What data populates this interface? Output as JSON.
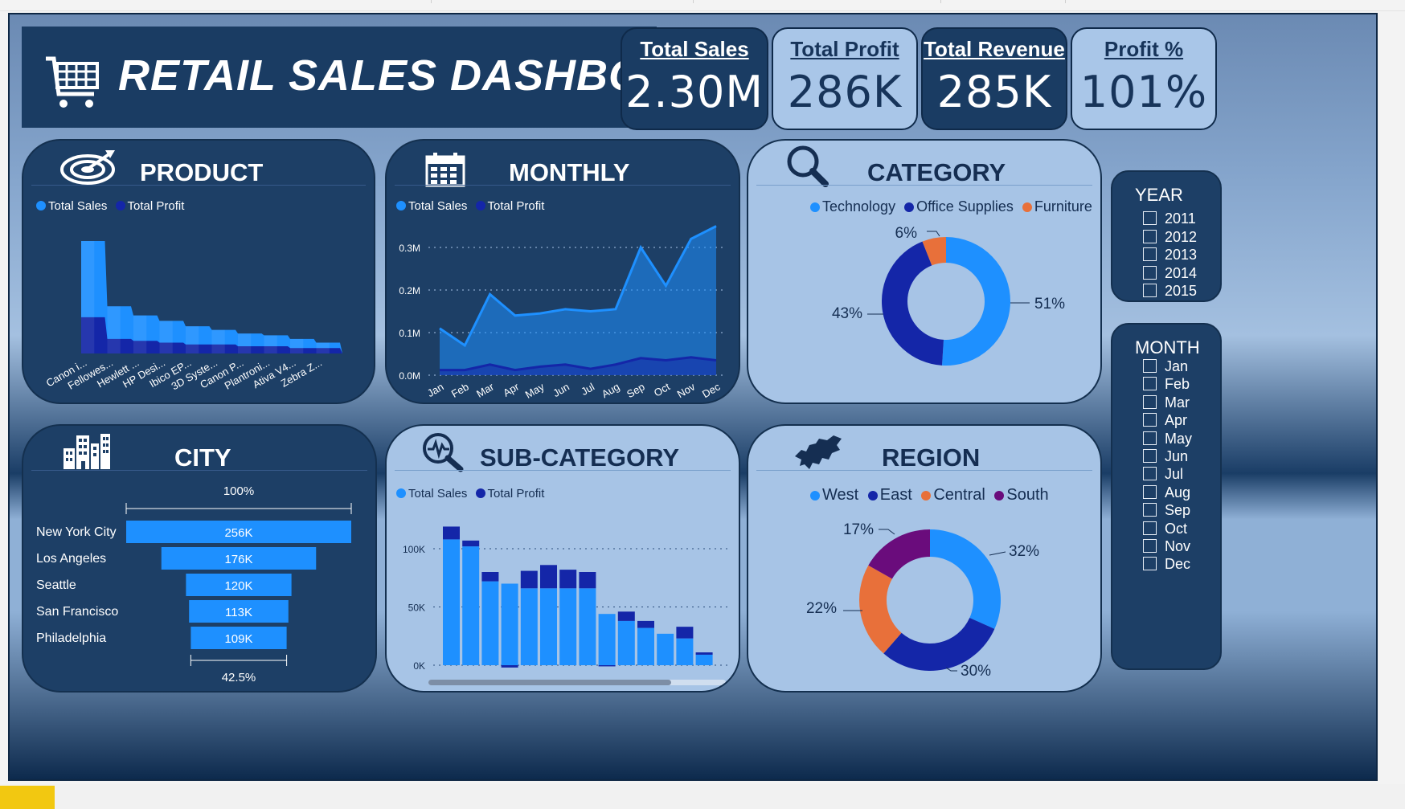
{
  "title": "RETAIL SALES DASHBOARD",
  "kpis": [
    {
      "label": "Total Sales",
      "value": "2.30M"
    },
    {
      "label": "Total Profit",
      "value": "286K"
    },
    {
      "label": "Total Revenue",
      "value": "285K"
    },
    {
      "label": "Profit %",
      "value": "101%"
    }
  ],
  "colors": {
    "sales": "#1e90ff",
    "profit": "#1426a8",
    "furniture": "#e8703a",
    "south": "#6a0c7c",
    "navy": "#1d3f66",
    "light": "#a7c4e6"
  },
  "panels": {
    "product": {
      "title": "PRODUCT",
      "icon": "target-icon"
    },
    "monthly": {
      "title": "MONTHLY",
      "icon": "calendar-icon"
    },
    "category": {
      "title": "CATEGORY",
      "icon": "magnifier-icon"
    },
    "city": {
      "title": "CITY",
      "icon": "buildings-icon"
    },
    "subcategory": {
      "title": "SUB-CATEGORY",
      "icon": "analytics-search-icon"
    },
    "region": {
      "title": "REGION",
      "icon": "world-map-icon"
    }
  },
  "legend_sales_profit": [
    "Total Sales",
    "Total Profit"
  ],
  "slicers": {
    "year": {
      "title": "YEAR",
      "options": [
        "2011",
        "2012",
        "2013",
        "2014",
        "2015"
      ]
    },
    "month": {
      "title": "MONTH",
      "options": [
        "Jan",
        "Feb",
        "Mar",
        "Apr",
        "May",
        "Jun",
        "Jul",
        "Aug",
        "Sep",
        "Oct",
        "Nov",
        "Dec"
      ]
    }
  },
  "chart_data": [
    {
      "id": "product",
      "type": "area",
      "categories": [
        "Canon i...",
        "Fellowes...",
        "Hewlett ...",
        "HP Desi...",
        "Ibico EP...",
        "3D Syste...",
        "Canon P...",
        "Plantroni...",
        "Ativa V4...",
        "Zebra Z..."
      ],
      "series": [
        {
          "name": "Total Sales",
          "values": [
            62,
            26,
            21,
            18,
            15,
            13,
            11,
            10,
            8,
            6
          ]
        },
        {
          "name": "Total Profit",
          "values": [
            20,
            8,
            7,
            6,
            5,
            5,
            4,
            4,
            3,
            3
          ]
        }
      ]
    },
    {
      "id": "monthly",
      "type": "area",
      "categories": [
        "Jan",
        "Feb",
        "Mar",
        "Apr",
        "May",
        "Jun",
        "Jul",
        "Aug",
        "Sep",
        "Oct",
        "Nov",
        "Dec"
      ],
      "yticks": [
        "0.0M",
        "0.1M",
        "0.2M",
        "0.3M"
      ],
      "ylim": [
        0,
        0.3
      ],
      "series": [
        {
          "name": "Total Sales",
          "values": [
            0.11,
            0.07,
            0.19,
            0.14,
            0.145,
            0.155,
            0.15,
            0.155,
            0.3,
            0.21,
            0.32,
            0.35
          ]
        },
        {
          "name": "Total Profit",
          "values": [
            0.012,
            0.012,
            0.025,
            0.012,
            0.02,
            0.025,
            0.015,
            0.025,
            0.04,
            0.035,
            0.042,
            0.035
          ]
        }
      ]
    },
    {
      "id": "category",
      "type": "pie",
      "labels": [
        "Technology",
        "Office Supplies",
        "Furniture"
      ],
      "values": [
        51,
        43,
        6
      ],
      "value_labels": [
        "51%",
        "43%",
        "6%"
      ],
      "colors": [
        "#1e90ff",
        "#1426a8",
        "#e8703a"
      ]
    },
    {
      "id": "city",
      "type": "bar",
      "categories": [
        "New York City",
        "Los Angeles",
        "Seattle",
        "San Francisco",
        "Philadelphia"
      ],
      "values": [
        256,
        176,
        120,
        113,
        109
      ],
      "value_labels": [
        "256K",
        "176K",
        "120K",
        "113K",
        "109K"
      ],
      "top_label": "100%",
      "bottom_label": "42.5%"
    },
    {
      "id": "subcategory",
      "type": "bar",
      "yticks": [
        "0K",
        "50K",
        "100K"
      ],
      "ylim": [
        0,
        100
      ],
      "series": [
        {
          "name": "Total Sales",
          "values": [
            108,
            102,
            72,
            70,
            66,
            66,
            66,
            66,
            44,
            38,
            32,
            27,
            23,
            9
          ]
        },
        {
          "name": "Total Profit",
          "values": [
            11,
            5,
            8,
            -2,
            15,
            20,
            16,
            14,
            -1,
            8,
            6,
            0,
            10,
            2
          ]
        }
      ]
    },
    {
      "id": "region",
      "type": "pie",
      "labels": [
        "West",
        "East",
        "Central",
        "South"
      ],
      "values": [
        32,
        30,
        22,
        17
      ],
      "value_labels": [
        "32%",
        "30%",
        "22%",
        "17%"
      ],
      "colors": [
        "#1e90ff",
        "#1426a8",
        "#e8703a",
        "#6a0c7c"
      ]
    }
  ]
}
